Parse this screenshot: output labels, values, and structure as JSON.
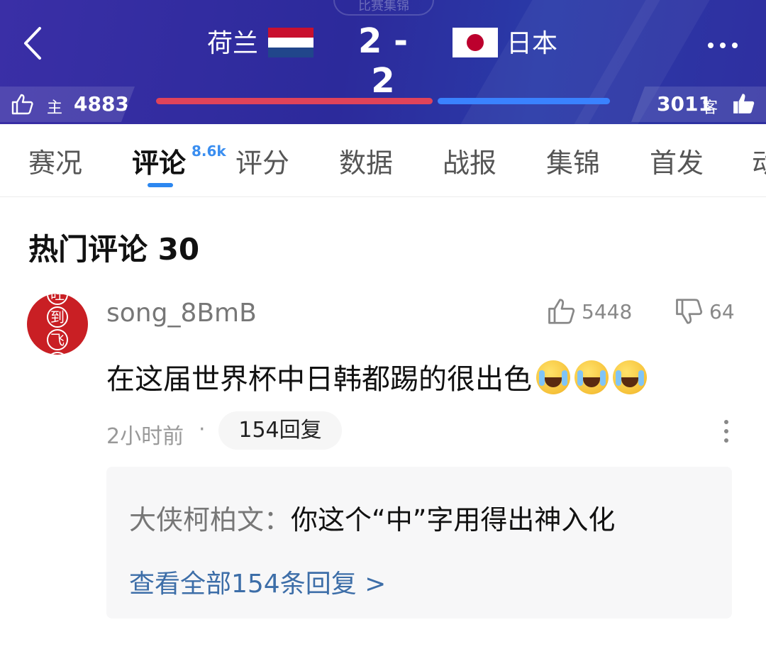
{
  "header": {
    "top_pill_text": "比赛集锦",
    "home_team": "荷兰",
    "away_team": "日本",
    "score": "2 - 2",
    "home_vote_label": "主",
    "home_votes": "4883",
    "away_vote_label": "客",
    "away_votes": "3011",
    "home_color": "#e0435a",
    "away_color": "#3a82ff",
    "home_vote_share": 0.6186
  },
  "tabs": {
    "items": [
      "赛况",
      "评论",
      "评分",
      "数据",
      "战报",
      "集锦",
      "首发",
      "动"
    ],
    "active": "评论",
    "comment_badge": "8.6k"
  },
  "section": {
    "title": "热门评论 30"
  },
  "comment": {
    "avatar_chars": [
      "旺",
      "到",
      "飞",
      "起"
    ],
    "username": "song_8BmB",
    "likes": "5448",
    "dislikes": "64",
    "text": "在这届世界杯中日韩都踢的很出色",
    "emoji": "crying-face",
    "time": "2小时前",
    "dot": "·",
    "reply_count_label": "154回复"
  },
  "reply": {
    "author": "大侠柯柏文：",
    "content": "你这个“中”字用得出神入化",
    "view_all": "查看全部154条回复 >"
  }
}
